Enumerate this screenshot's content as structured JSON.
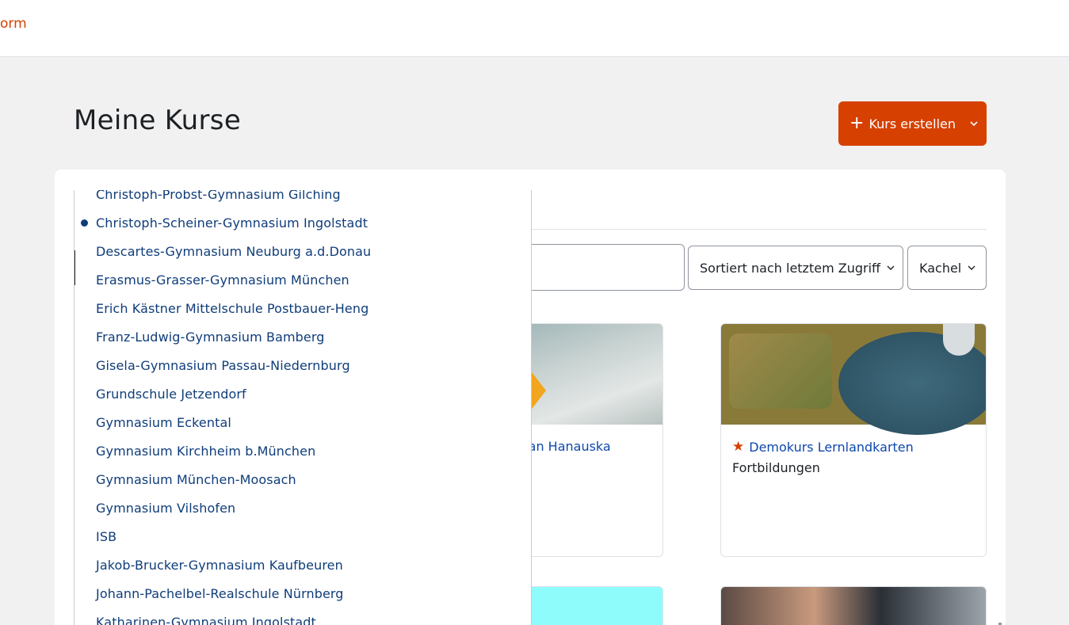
{
  "header": {
    "brand_fragment": "orm"
  },
  "page": {
    "title": "Meine Kurse"
  },
  "toolbar": {
    "create_label": "Kurs erstellen",
    "plus_icon": "plus-icon",
    "caret_icon": "chevron-down-icon"
  },
  "filters": {
    "search_placeholder": "",
    "sort_label": "Sortiert nach letztem Zugriff",
    "view_label": "Kachel"
  },
  "courses": [
    {
      "title": "fan Hanauska",
      "category": ""
    },
    {
      "title": "Demokurs Lernlandkarten",
      "category": "Fortbildungen",
      "starred": true
    },
    {
      "title": "",
      "category": ""
    },
    {
      "title": "",
      "category": ""
    }
  ],
  "dropdown": {
    "selected_index": 1,
    "items": [
      "Christoph-Probst-Gymnasium Gilching",
      "Christoph-Scheiner-Gymnasium Ingolstadt",
      "Descartes-Gymnasium Neuburg a.d.Donau",
      "Erasmus-Grasser-Gymnasium München",
      "Erich Kästner Mittelschule Postbauer-Heng",
      "Franz-Ludwig-Gymnasium Bamberg",
      "Gisela-Gymnasium Passau-Niedernburg",
      "Grundschule Jetzendorf",
      "Gymnasium Eckental",
      "Gymnasium Kirchheim b.München",
      "Gymnasium München-Moosach",
      "Gymnasium Vilshofen",
      "ISB",
      "Jakob-Brucker-Gymnasium Kaufbeuren",
      "Johann-Pachelbel-Realschule Nürnberg",
      "Katharinen-Gymnasium Ingolstadt"
    ]
  },
  "colors": {
    "brand": "#d64000",
    "link": "#0f47ad",
    "dropdown_text": "#0f3d7a"
  }
}
